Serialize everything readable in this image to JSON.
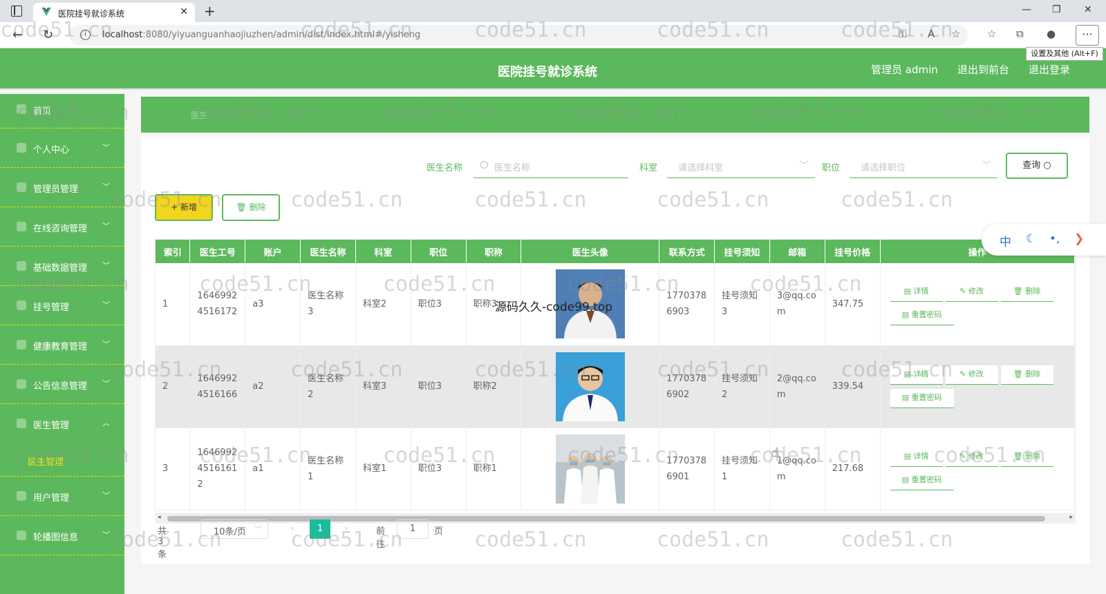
{
  "browser": {
    "tab_title": "医院挂号就诊系统",
    "url_host": "localhost",
    "url_path": ":8080/yiyuanguanhaojiuzhen/admin/dist/index.html#/yisheng",
    "tooltip": "设置及其他 (Alt+F)"
  },
  "header": {
    "title": "医院挂号就诊系统",
    "user": "管理员 admin",
    "front_link": "退出到前台",
    "logout_link": "退出登录"
  },
  "sidebar": {
    "items": [
      {
        "label": "首页"
      },
      {
        "label": "个人中心"
      },
      {
        "label": "管理员管理"
      },
      {
        "label": "在线咨询管理"
      },
      {
        "label": "基础数据管理"
      },
      {
        "label": "挂号管理"
      },
      {
        "label": "健康教育管理"
      },
      {
        "label": "公告信息管理"
      },
      {
        "label": "医生管理"
      },
      {
        "label": "用户管理"
      },
      {
        "label": "轮播图信息"
      }
    ],
    "submenu_active": "医生管理"
  },
  "breadcrumb": "医生",
  "search": {
    "name_label": "医生名称",
    "name_placeholder": "医生名称",
    "dept_label": "科室",
    "dept_placeholder": "请选择科室",
    "pos_label": "职位",
    "pos_placeholder": "请选择职位",
    "query_btn": "查询"
  },
  "actions": {
    "add": "+ 新增",
    "delete": "删除"
  },
  "table": {
    "columns": [
      "索引",
      "医生工号",
      "账户",
      "医生名称",
      "科室",
      "职位",
      "职称",
      "医生头像",
      "联系方式",
      "挂号须知",
      "邮箱",
      "挂号价格",
      "操作"
    ],
    "rows": [
      {
        "index": "1",
        "code": "16469924516172",
        "account": "a3",
        "name": "医生名称3",
        "dept": "科室2",
        "position": "职位3",
        "title": "职称3",
        "phone": "17703786903",
        "notice": "挂号须知3",
        "email": "3@qq.com",
        "price": "347.75"
      },
      {
        "index": "2",
        "code": "16469924516166",
        "account": "a2",
        "name": "医生名称2",
        "dept": "科室3",
        "position": "职位3",
        "title": "职称2",
        "phone": "17703786902",
        "notice": "挂号须知2",
        "email": "2@qq.com",
        "price": "339.54"
      },
      {
        "index": "3",
        "code": "164699245161612",
        "account": "a1",
        "name": "医生名称1",
        "dept": "科室1",
        "position": "职位3",
        "title": "职称1",
        "phone": "17703786901",
        "notice": "挂号须知1",
        "email": "1@qq.com",
        "price": "217.68"
      }
    ],
    "op_detail": "详情",
    "op_edit": "修改",
    "op_delete": "删除",
    "op_reset": "重置密码"
  },
  "pager": {
    "total": "共 3 条",
    "size": "10条/页",
    "current": "1",
    "goto_label": "前往",
    "goto_value": "1",
    "page_suffix": "页"
  },
  "ime": {
    "lang": "中"
  },
  "overlay_text": "源码久久-code99.top",
  "watermark": "code51.cn"
}
